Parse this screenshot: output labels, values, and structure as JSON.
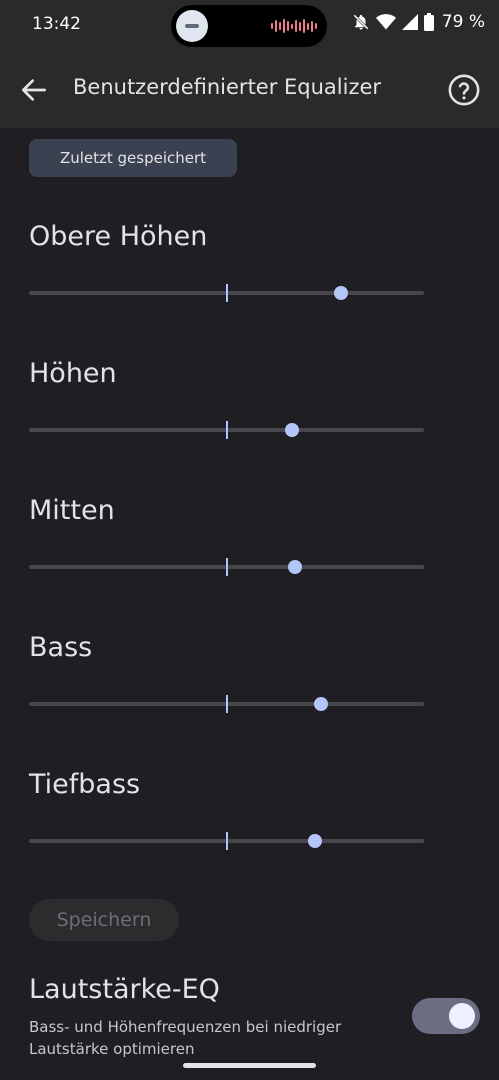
{
  "status_bar": {
    "time": "13:42",
    "battery": "79 %",
    "icons": [
      "media-island",
      "audio-wave-icon",
      "bell-off-icon",
      "wifi-icon",
      "signal-icon",
      "battery-icon"
    ]
  },
  "header": {
    "title": "Benutzerdefinierter Equalizer",
    "back_icon": "arrow-left-icon",
    "help_icon": "help-circle-icon"
  },
  "preset": {
    "label": "Zuletzt gespeichert"
  },
  "bands": [
    {
      "label": "Obere Höhen",
      "value": 0.79
    },
    {
      "label": "Höhen",
      "value": 0.666
    },
    {
      "label": "Mitten",
      "value": 0.673
    },
    {
      "label": "Bass",
      "value": 0.74
    },
    {
      "label": "Tiefbass",
      "value": 0.724
    }
  ],
  "save": {
    "label": "Speichern",
    "enabled": false
  },
  "volume_eq": {
    "title": "Lautstärke-EQ",
    "description": "Bass- und Höhenfrequenzen bei niedriger Lautstärke optimieren",
    "enabled": true
  },
  "colors": {
    "accent": "#b4c5f8",
    "background": "#1f1e23",
    "app_bar": "#2a2a2d"
  }
}
